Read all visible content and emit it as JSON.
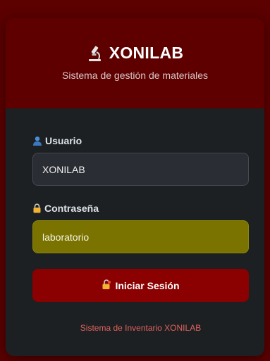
{
  "header": {
    "brand_name": "XONILAB",
    "brand_icon": "microscope-icon",
    "subtitle": "Sistema de gestión de materiales"
  },
  "form": {
    "username": {
      "label": "Usuario",
      "icon": "user-icon",
      "value": "XONILAB"
    },
    "password": {
      "label": "Contraseña",
      "icon": "lock-icon",
      "value": "laboratorio"
    },
    "submit": {
      "label": "Iniciar Sesión",
      "icon": "unlocked-lock-icon"
    }
  },
  "footer": {
    "text": "Sistema de Inventario XONILAB"
  },
  "colors": {
    "background": "#5c0000",
    "header": "#5f0000",
    "card": "#1c2022",
    "button": "#8b0000",
    "autofill": "#7a7300",
    "footer_text": "#e0625e"
  }
}
